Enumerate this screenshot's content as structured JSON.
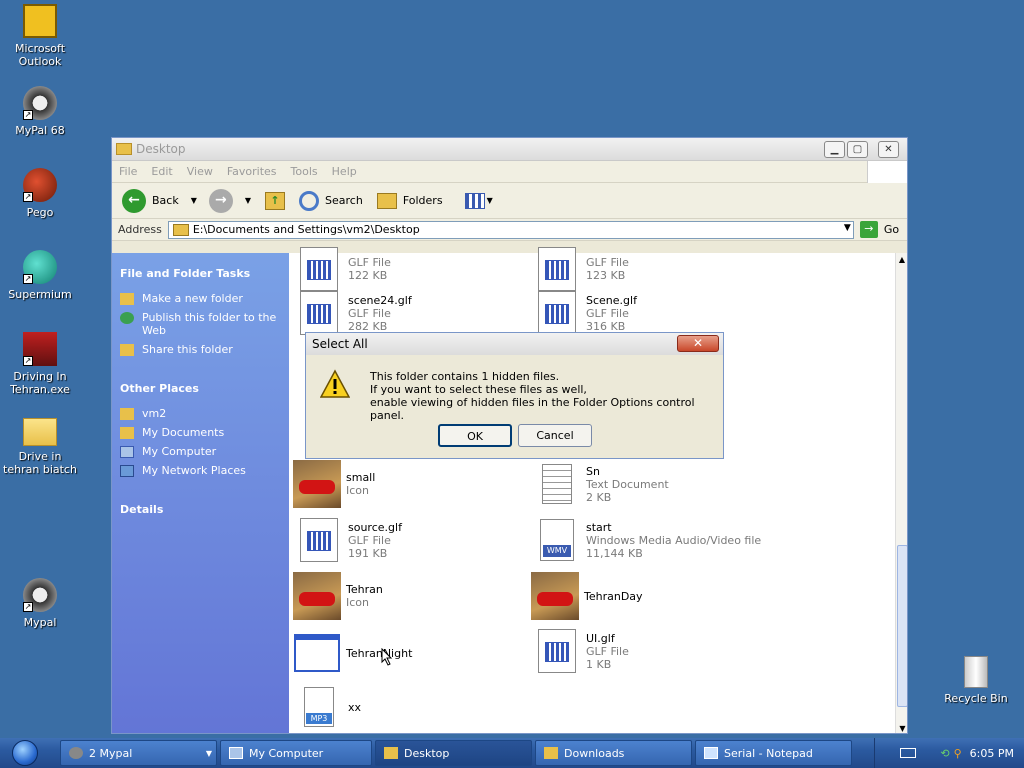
{
  "desktop": {
    "icons": [
      {
        "label": "Microsoft Outlook",
        "icon": "outlook-icon"
      },
      {
        "label": "MyPal 68",
        "icon": "raccoon-icon"
      },
      {
        "label": "Pego",
        "icon": "pego-icon"
      },
      {
        "label": "Supermium",
        "icon": "supermium-icon"
      },
      {
        "label": "Driving In Tehran.exe",
        "icon": "car-icon"
      },
      {
        "label": "Drive in tehran biatch",
        "icon": "folder-icon"
      },
      {
        "label": "Mypal",
        "icon": "raccoon-icon"
      },
      {
        "label": "Recycle Bin",
        "icon": "recycle-bin-icon"
      }
    ]
  },
  "window": {
    "title": "Desktop",
    "menu": [
      "File",
      "Edit",
      "View",
      "Favorites",
      "Tools",
      "Help"
    ],
    "toolbar": {
      "back": "Back",
      "search": "Search",
      "folders": "Folders"
    },
    "address": {
      "label": "Address",
      "value": "E:\\Documents and Settings\\vm2\\Desktop",
      "go": "Go"
    }
  },
  "leftpane": {
    "file_tasks": {
      "title": "File and Folder Tasks",
      "items": [
        "Make a new folder",
        "Publish this folder to the Web",
        "Share this folder"
      ]
    },
    "other_places": {
      "title": "Other Places",
      "items": [
        "vm2",
        "My Documents",
        "My Computer",
        "My Network Places"
      ]
    },
    "details": {
      "title": "Details"
    }
  },
  "files": [
    {
      "name": "",
      "type": "GLF File",
      "size": "122 KB"
    },
    {
      "name": "",
      "type": "GLF File",
      "size": "123 KB"
    },
    {
      "name": "scene24.glf",
      "type": "GLF File",
      "size": "282 KB"
    },
    {
      "name": "Scene.glf",
      "type": "GLF File",
      "size": "316 KB"
    },
    {
      "name": "small",
      "type": "Icon",
      "size": ""
    },
    {
      "name": "Sn",
      "type": "Text Document",
      "size": "2 KB"
    },
    {
      "name": "source.glf",
      "type": "GLF File",
      "size": "191 KB"
    },
    {
      "name": "start",
      "type": "Windows Media Audio/Video file",
      "size": "11,144 KB"
    },
    {
      "name": "Tehran",
      "type": "Icon",
      "size": ""
    },
    {
      "name": "TehranDay",
      "type": "",
      "size": ""
    },
    {
      "name": "TehranNight",
      "type": "",
      "size": ""
    },
    {
      "name": "UI.glf",
      "type": "GLF File",
      "size": "1 KB"
    },
    {
      "name": "xx",
      "type": "",
      "size": ""
    }
  ],
  "dialog": {
    "title": "Select All",
    "line1": "This folder contains 1 hidden files.",
    "line2": "If you want to select these files as well,",
    "line3": "enable viewing of hidden files in the Folder Options control panel.",
    "ok": "OK",
    "cancel": "Cancel"
  },
  "taskbar": {
    "buttons": [
      {
        "label": "2 Mypal"
      },
      {
        "label": "My Computer"
      },
      {
        "label": "Desktop"
      },
      {
        "label": "Downloads"
      },
      {
        "label": "Serial - Notepad"
      }
    ],
    "clock": "6:05 PM"
  }
}
